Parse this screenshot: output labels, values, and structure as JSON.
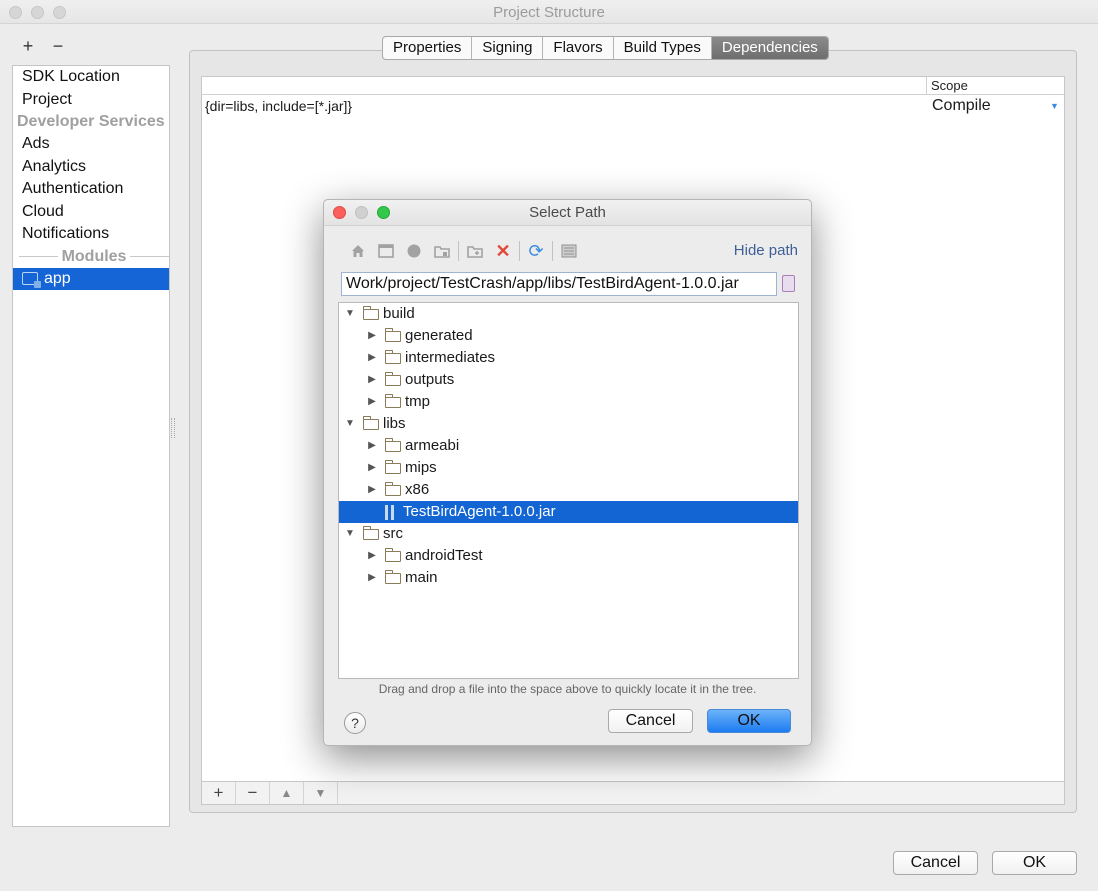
{
  "window": {
    "title": "Project Structure"
  },
  "left_toolbar": {
    "add_label": "+",
    "remove_label": "−"
  },
  "sidebar": {
    "items": [
      {
        "label": "SDK Location",
        "type": "item"
      },
      {
        "label": "Project",
        "type": "item"
      },
      {
        "label": "Developer Services",
        "type": "header"
      },
      {
        "label": "Ads",
        "type": "item"
      },
      {
        "label": "Analytics",
        "type": "item"
      },
      {
        "label": "Authentication",
        "type": "item"
      },
      {
        "label": "Cloud",
        "type": "item"
      },
      {
        "label": "Notifications",
        "type": "item"
      },
      {
        "label": "Modules",
        "type": "header"
      },
      {
        "label": "app",
        "type": "module",
        "selected": true
      }
    ]
  },
  "tabs": [
    {
      "label": "Properties",
      "active": false
    },
    {
      "label": "Signing",
      "active": false
    },
    {
      "label": "Flavors",
      "active": false
    },
    {
      "label": "Build Types",
      "active": false
    },
    {
      "label": "Dependencies",
      "active": true
    }
  ],
  "dependencies": {
    "columns": {
      "scope": "Scope"
    },
    "rows": [
      {
        "dependency": "{dir=libs, include=[*.jar]}",
        "scope": "Compile"
      }
    ],
    "toolbar": {
      "add": "+",
      "remove": "−",
      "up": "▲",
      "down": "▼"
    }
  },
  "footer": {
    "cancel_label": "Cancel",
    "ok_label": "OK"
  },
  "dialog": {
    "title": "Select Path",
    "hide_path_label": "Hide path",
    "path_value": "Work/project/TestCrash/app/libs/TestBirdAgent-1.0.0.jar",
    "tree": [
      {
        "label": "build",
        "level": 0,
        "expanded": true,
        "kind": "folder"
      },
      {
        "label": "generated",
        "level": 1,
        "expanded": false,
        "kind": "folder"
      },
      {
        "label": "intermediates",
        "level": 1,
        "expanded": false,
        "kind": "folder"
      },
      {
        "label": "outputs",
        "level": 1,
        "expanded": false,
        "kind": "folder"
      },
      {
        "label": "tmp",
        "level": 1,
        "expanded": false,
        "kind": "folder"
      },
      {
        "label": "libs",
        "level": 0,
        "expanded": true,
        "kind": "folder"
      },
      {
        "label": "armeabi",
        "level": 1,
        "expanded": false,
        "kind": "folder"
      },
      {
        "label": "mips",
        "level": 1,
        "expanded": false,
        "kind": "folder"
      },
      {
        "label": "x86",
        "level": 1,
        "expanded": false,
        "kind": "folder"
      },
      {
        "label": "TestBirdAgent-1.0.0.jar",
        "level": 1,
        "kind": "jar",
        "selected": true
      },
      {
        "label": "src",
        "level": 0,
        "expanded": true,
        "kind": "folder"
      },
      {
        "label": "androidTest",
        "level": 1,
        "expanded": false,
        "kind": "folder"
      },
      {
        "label": "main",
        "level": 1,
        "expanded": false,
        "kind": "folder"
      }
    ],
    "hint": "Drag and drop a file into the space above to quickly locate it in the tree.",
    "help_label": "?",
    "cancel_label": "Cancel",
    "ok_label": "OK"
  },
  "colors": {
    "selection": "#1265d2",
    "primary_button": "#1d7bf1",
    "link": "#3f5f97"
  }
}
